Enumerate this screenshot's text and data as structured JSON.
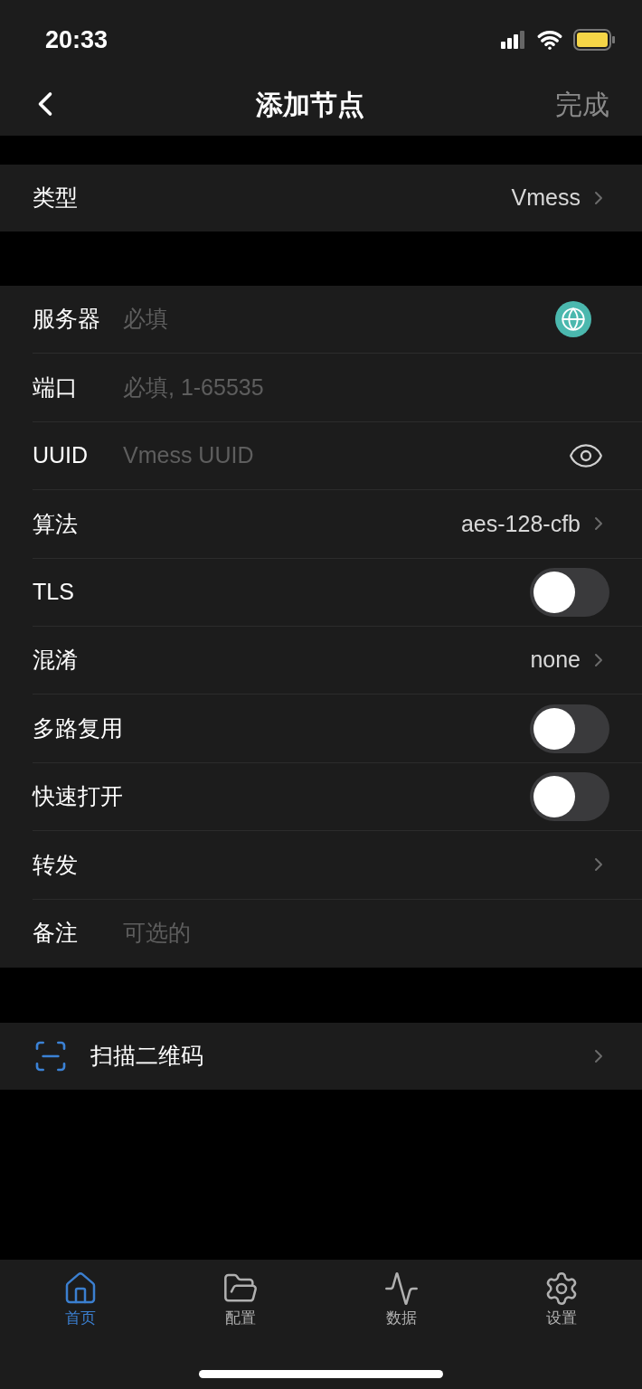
{
  "status_bar": {
    "time": "20:33"
  },
  "nav": {
    "title": "添加节点",
    "action": "完成"
  },
  "type_row": {
    "label": "类型",
    "value": "Vmess"
  },
  "fields": [
    {
      "kind": "input",
      "label": "服务器",
      "placeholder": "必填"
    },
    {
      "kind": "input",
      "label": "端口",
      "placeholder": "必填, 1-65535"
    },
    {
      "kind": "input",
      "label": "UUID",
      "placeholder": "Vmess UUID"
    },
    {
      "kind": "select",
      "label": "算法",
      "value": "aes-128-cfb"
    },
    {
      "kind": "toggle",
      "label": "TLS",
      "on": false
    },
    {
      "kind": "select",
      "label": "混淆",
      "value": "none"
    },
    {
      "kind": "toggle",
      "label": "多路复用",
      "on": false
    },
    {
      "kind": "toggle",
      "label": "快速打开",
      "on": false
    },
    {
      "kind": "select",
      "label": "转发"
    },
    {
      "kind": "input",
      "label": "备注",
      "placeholder": "可选的"
    }
  ],
  "scan_row": {
    "label": "扫描二维码"
  },
  "tabs": [
    {
      "label": "首页",
      "selected": true
    },
    {
      "label": "配置",
      "selected": false
    },
    {
      "label": "数据",
      "selected": false
    },
    {
      "label": "设置",
      "selected": false
    }
  ]
}
